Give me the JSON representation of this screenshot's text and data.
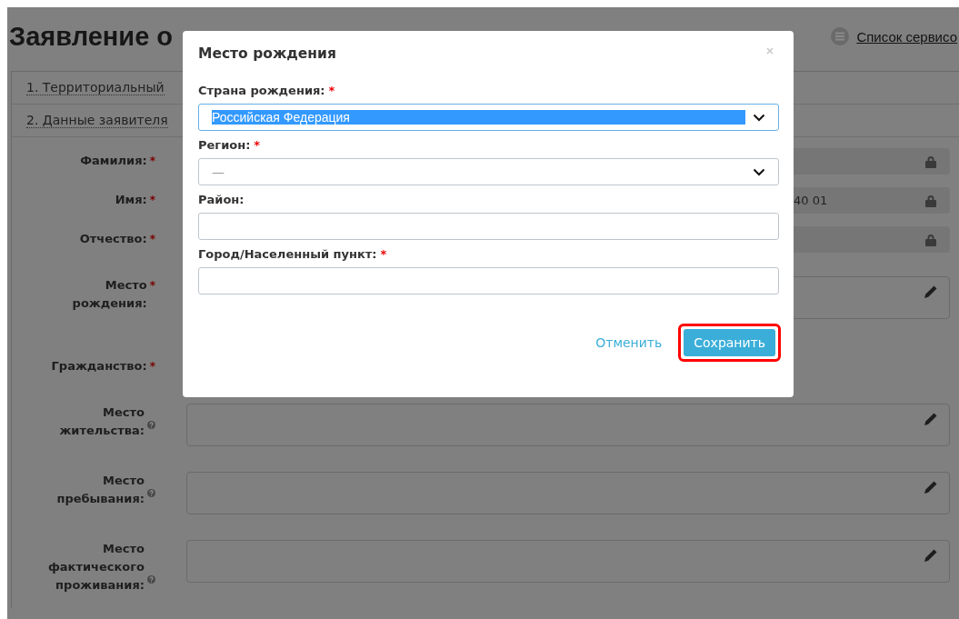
{
  "page": {
    "title": "Заявление о",
    "services_link": "Список сервисо",
    "sections": [
      {
        "label": "1. Территориальный"
      },
      {
        "label": "2. Данные заявителя"
      }
    ],
    "fields": [
      {
        "label": "Фамилия:",
        "required_mark": "*",
        "help": false,
        "kind": "locked"
      },
      {
        "label": "Имя:",
        "required_mark": "*",
        "help": false,
        "kind": "locked",
        "value": "40 01"
      },
      {
        "label": "Отчество:",
        "required_mark": "*",
        "help": false,
        "kind": "locked"
      },
      {
        "label": "Место рождения:",
        "required_mark": "*",
        "help": false,
        "kind": "editable"
      },
      {
        "label": "Гражданство:",
        "required_mark": "*",
        "help": false,
        "kind": "covered"
      },
      {
        "label": "Место жительства:",
        "help": true,
        "kind": "editable"
      },
      {
        "label": "Место пребывания:",
        "help": true,
        "kind": "editable"
      },
      {
        "label": "Место фактического проживания:",
        "help": true,
        "kind": "editable"
      }
    ]
  },
  "modal": {
    "title": "Место рождения",
    "fields": [
      {
        "label": "Страна рождения:",
        "required_mark": "*",
        "kind": "select",
        "value": "Российская Федерация",
        "text_selected": true
      },
      {
        "label": "Регион:",
        "required_mark": "*",
        "kind": "select",
        "value": "—",
        "text_selected": false
      },
      {
        "label": "Район:",
        "kind": "text"
      },
      {
        "label": "Город/Населенный пункт:",
        "required_mark": "*",
        "kind": "text"
      }
    ],
    "cancel": "Отменить",
    "save": {
      "label": "Сохранить",
      "highlighted": true
    }
  }
}
